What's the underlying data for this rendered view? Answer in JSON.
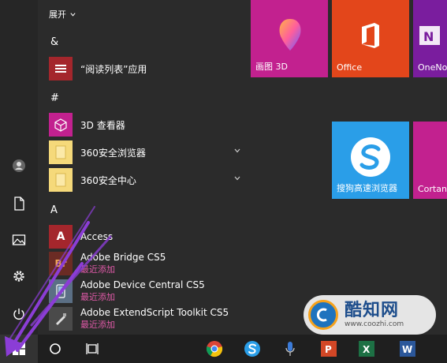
{
  "app_list": {
    "expand_label": "展开",
    "groups": [
      {
        "letter": "&",
        "apps": [
          {
            "name": "“阅读列表”应用"
          }
        ]
      },
      {
        "letter": "#",
        "apps": [
          {
            "name": "3D 查看器"
          },
          {
            "name": "360安全浏览器"
          },
          {
            "name": "360安全中心"
          }
        ]
      },
      {
        "letter": "A",
        "apps": [
          {
            "name": "Access",
            "icon_text": "A"
          },
          {
            "name": "Adobe Bridge CS5",
            "icon_text": "Br",
            "badge": "最近添加"
          },
          {
            "name": "Adobe Device Central CS5",
            "badge": "最近添加"
          },
          {
            "name": "Adobe ExtendScript Toolkit CS5",
            "badge": "最近添加"
          }
        ]
      }
    ]
  },
  "tiles": [
    {
      "label": "画图 3D",
      "color": "#c2218f"
    },
    {
      "label": "Office",
      "color": "#e3461b"
    },
    {
      "label": "OneNo",
      "color": "#7a1d9e"
    },
    {
      "label": "搜狗高速浏览器",
      "color": "#2a9ee8"
    },
    {
      "label": "Cortana",
      "color": "#c2218f"
    }
  ],
  "watermark": {
    "brand": "酷知网",
    "url": "www.coozhi.com"
  },
  "colors": {
    "pink": "#c2218f",
    "yellow": "#f5d97a",
    "red_app": "#a4262c",
    "badge": "#e05aa8",
    "arrow": "#8b3dd6"
  },
  "rail_icons": [
    "user-icon",
    "document-icon",
    "pictures-icon",
    "settings-icon",
    "power-icon"
  ],
  "taskbar_icons": [
    "windows-start-icon",
    "search-circle-icon",
    "task-view-icon",
    "chrome-icon",
    "sogou-icon",
    "mic-icon",
    "powerpoint-icon",
    "excel-icon",
    "word-icon"
  ]
}
